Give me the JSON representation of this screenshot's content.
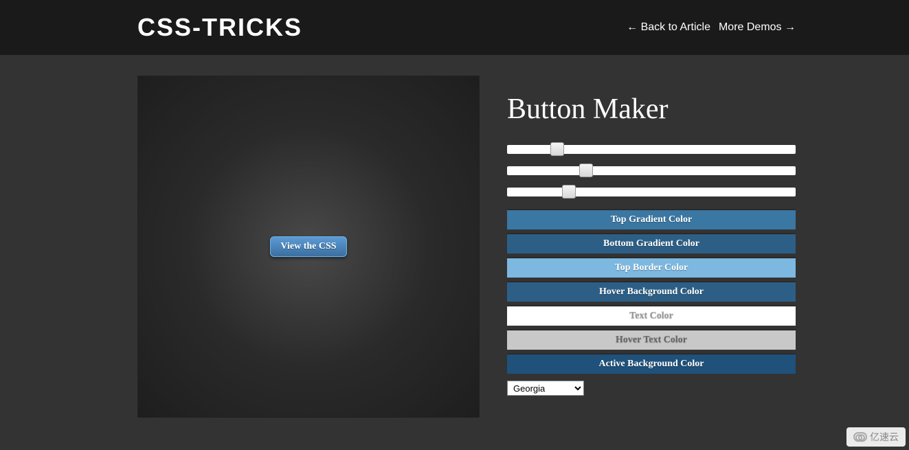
{
  "header": {
    "logo": "CSS-TRICKS",
    "nav": {
      "back": "← Back to Article",
      "more": "More Demos →"
    }
  },
  "preview": {
    "button_label": "View the CSS"
  },
  "controls": {
    "title": "Button Maker",
    "sliders": [
      {
        "position": 15
      },
      {
        "position": 25
      },
      {
        "position": 19
      }
    ],
    "color_buttons": [
      {
        "label": "Top Gradient Color",
        "bg": "#3b77a3",
        "fg": "#ffffff"
      },
      {
        "label": "Bottom Gradient Color",
        "bg": "#2d5f86",
        "fg": "#ffffff"
      },
      {
        "label": "Top Border Color",
        "bg": "#7db8e0",
        "fg": "#ffffff"
      },
      {
        "label": "Hover Background Color",
        "bg": "#2d5f86",
        "fg": "#ffffff"
      },
      {
        "label": "Text Color",
        "bg": "#ffffff",
        "fg": "#999999"
      },
      {
        "label": "Hover Text Color",
        "bg": "#c8c8c8",
        "fg": "#666666"
      },
      {
        "label": "Active Background Color",
        "bg": "#1f517b",
        "fg": "#ffffff"
      }
    ],
    "font_select": {
      "value": "Georgia"
    }
  },
  "watermark": "亿速云"
}
